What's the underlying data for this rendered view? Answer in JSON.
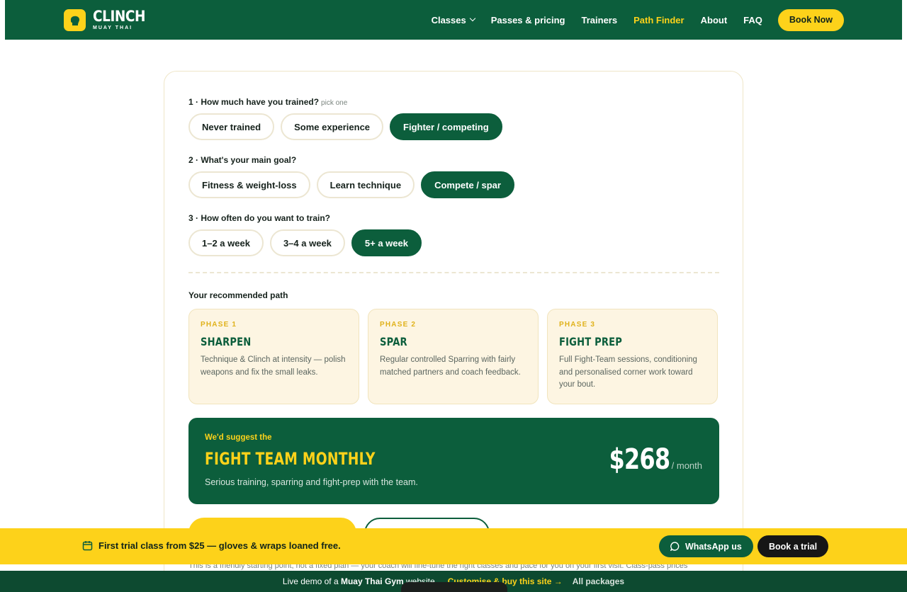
{
  "brand": {
    "name": "CLINCH",
    "subtitle": "MUAY THAI"
  },
  "nav": {
    "items": [
      {
        "label": "Classes",
        "dropdown": true,
        "active": false
      },
      {
        "label": "Passes & pricing",
        "active": false
      },
      {
        "label": "Trainers",
        "active": false
      },
      {
        "label": "Path Finder",
        "active": true
      },
      {
        "label": "About",
        "active": false
      },
      {
        "label": "FAQ",
        "active": false
      }
    ],
    "cta": "Book Now"
  },
  "questions": [
    {
      "label": "1 · How much have you trained?",
      "hint": "pick one",
      "options": [
        "Never trained",
        "Some experience",
        "Fighter / competing"
      ],
      "selected": 2
    },
    {
      "label": "2 · What's your main goal?",
      "hint": "",
      "options": [
        "Fitness & weight-loss",
        "Learn technique",
        "Compete / spar"
      ],
      "selected": 2
    },
    {
      "label": "3 · How often do you want to train?",
      "hint": "",
      "options": [
        "1–2 a week",
        "3–4 a week",
        "5+ a week"
      ],
      "selected": 2
    }
  ],
  "recommendation": {
    "title": "Your recommended path",
    "phases": [
      {
        "num": "PHASE 1",
        "title": "SHARPEN",
        "desc": "Technique & Clinch at intensity — polish weapons and fix the small leaks."
      },
      {
        "num": "PHASE 2",
        "title": "SPAR",
        "desc": "Regular controlled Sparring with fairly matched partners and coach feedback."
      },
      {
        "num": "PHASE 3",
        "title": "FIGHT PREP",
        "desc": "Full Fight-Team sessions, conditioning and personalised corner work toward your bout."
      }
    ]
  },
  "suggestion": {
    "pre": "We'd suggest the",
    "plan": "FIGHT TEAM MONTHLY",
    "desc": "Serious training, sparring and fight-prep with the team.",
    "price": "$268",
    "per": "/ month"
  },
  "footnote": "This is a friendly starting point, not a fixed plan — your coach will fine-tune the right classes and pace for you on your first visit. Class-pass prices",
  "promo": {
    "text": "First trial class from $25 — gloves & wraps loaned free.",
    "whatsapp": "WhatsApp us",
    "trial": "Book a trial"
  },
  "demo": {
    "prefix": "Live demo of a",
    "site": "Muay Thai Gym",
    "suffix": "website",
    "link": "Customise & buy this site →",
    "packages": "All packages"
  },
  "colors": {
    "primary": "#0c5e3c",
    "accent": "#fdd21a",
    "cream": "#fdf5e2"
  }
}
